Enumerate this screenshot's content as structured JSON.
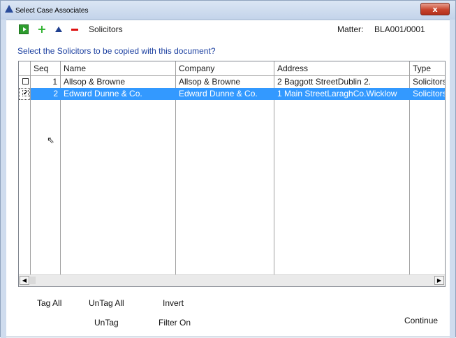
{
  "window": {
    "title": "Select Case Associates",
    "close_label": "x"
  },
  "toolbar": {
    "label": "Solicitors",
    "icons": [
      "export-icon",
      "add-icon",
      "move-up-icon",
      "remove-icon"
    ]
  },
  "matter": {
    "label": "Matter:",
    "value": "BLA001/0001"
  },
  "prompt": "Select the Solicitors to be copied with this document?",
  "grid": {
    "columns": [
      "Seq",
      "Name",
      "Company",
      "Address",
      "Type"
    ],
    "rows": [
      {
        "checked": false,
        "seq": "1",
        "name": "Allsop & Browne",
        "company": "Allsop & Browne",
        "address": "2 Baggott StreetDublin 2.",
        "type": "Solicitors",
        "selected": false
      },
      {
        "checked": true,
        "seq": "2",
        "name": "Edward Dunne & Co.",
        "company": "Edward Dunne & Co.",
        "address": "1 Main StreetLaraghCo.Wicklow",
        "type": "Solicitors",
        "selected": true
      }
    ]
  },
  "buttons": {
    "tag_all": "Tag All",
    "untag_all": "UnTag All",
    "invert": "Invert",
    "untag": "UnTag",
    "filter_on": "Filter On",
    "continue": "Continue"
  },
  "colors": {
    "selection": "#3399ff",
    "prompt_text": "#1b3fa0",
    "close_button": "#c8452d"
  }
}
